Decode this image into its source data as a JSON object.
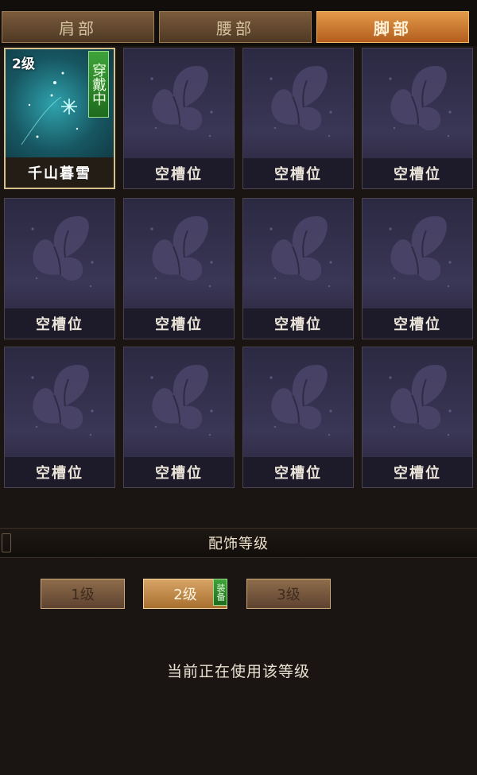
{
  "tabs": [
    {
      "label": "肩部",
      "active": false
    },
    {
      "label": "腰部",
      "active": false
    },
    {
      "label": "脚部",
      "active": true
    }
  ],
  "slots": [
    {
      "label": "千山暮雪",
      "equipped": true,
      "level_tag": "2级",
      "wear_badge": "穿戴中"
    },
    {
      "label": "空槽位",
      "equipped": false
    },
    {
      "label": "空槽位",
      "equipped": false
    },
    {
      "label": "空槽位",
      "equipped": false
    },
    {
      "label": "空槽位",
      "equipped": false
    },
    {
      "label": "空槽位",
      "equipped": false
    },
    {
      "label": "空槽位",
      "equipped": false
    },
    {
      "label": "空槽位",
      "equipped": false
    },
    {
      "label": "空槽位",
      "equipped": false
    },
    {
      "label": "空槽位",
      "equipped": false
    },
    {
      "label": "空槽位",
      "equipped": false
    },
    {
      "label": "空槽位",
      "equipped": false
    }
  ],
  "level_section": {
    "title": "配饰等级",
    "levels": [
      {
        "label": "1级",
        "active": false
      },
      {
        "label": "2级",
        "active": true
      },
      {
        "label": "3级",
        "active": false
      }
    ],
    "equip_badge": "装备",
    "status": "当前正在使用该等级"
  },
  "colors": {
    "active_tab": "#e39a48",
    "slot_bg": "#2b2942",
    "equipped_glow": "#2fa3ad",
    "badge_green": "#3ea33a"
  }
}
